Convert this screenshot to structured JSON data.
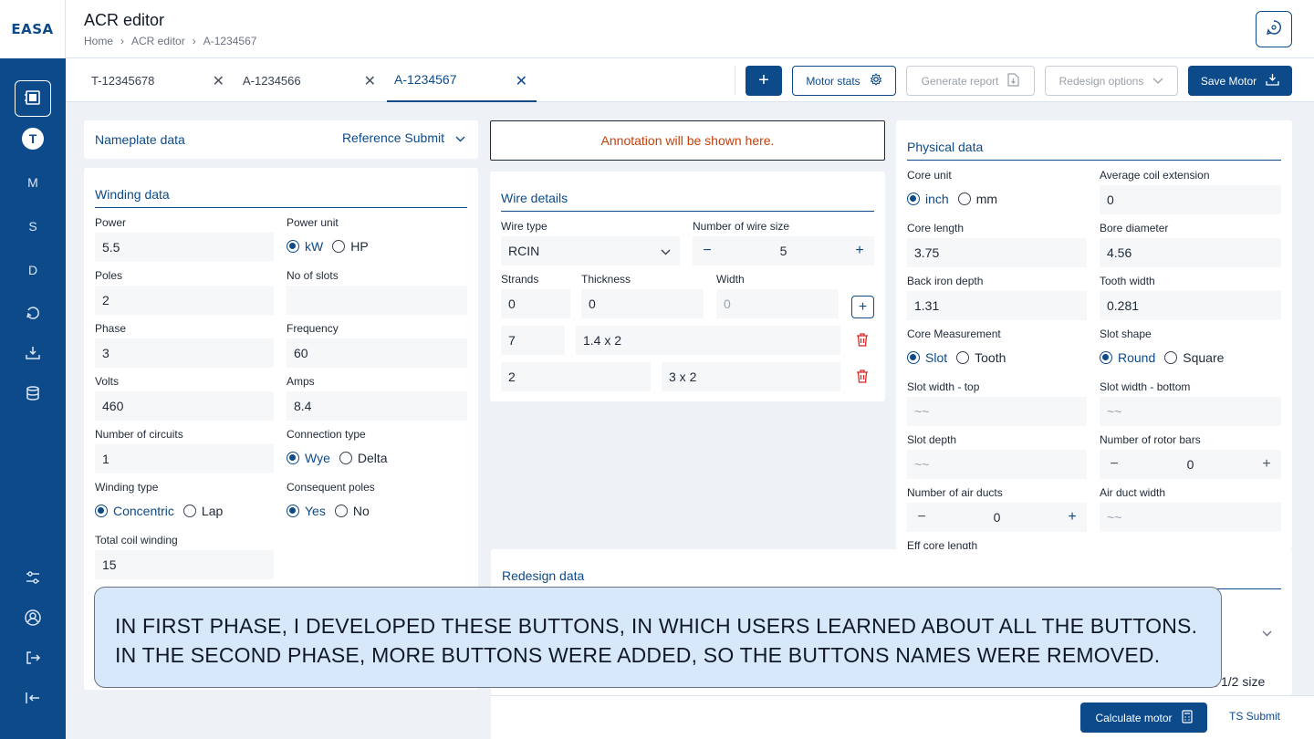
{
  "app": {
    "logo": "EASA",
    "title": "ACR editor",
    "breadcrumb": [
      "Home",
      "ACR editor",
      "A-1234567"
    ]
  },
  "sidebar": {
    "items": [
      {
        "icon": "motor-icon"
      },
      {
        "label": "T"
      },
      {
        "label": "M"
      },
      {
        "label": "S"
      },
      {
        "label": "D"
      },
      {
        "icon": "refresh-icon"
      },
      {
        "icon": "download-icon"
      },
      {
        "icon": "database-icon"
      }
    ],
    "bottom": [
      {
        "icon": "sliders-icon"
      },
      {
        "icon": "user-circle-icon"
      },
      {
        "icon": "logout-icon"
      },
      {
        "icon": "collapse-icon"
      }
    ]
  },
  "tabs": [
    {
      "label": "T-12345678"
    },
    {
      "label": "A-1234566"
    },
    {
      "label": "A-1234567",
      "active": true
    }
  ],
  "toolbar": {
    "add": "+",
    "motor_stats": "Motor stats",
    "generate_report": "Generate report",
    "redesign_options": "Redesign options",
    "save_motor": "Save Motor"
  },
  "nameplate": {
    "title": "Nameplate data",
    "reference": "Reference Submit"
  },
  "winding": {
    "title": "Winding data",
    "power_label": "Power",
    "power": "5.5",
    "power_unit_label": "Power unit",
    "power_unit_options": [
      "kW",
      "HP"
    ],
    "poles_label": "Poles",
    "poles": "2",
    "slots_label": "No of slots",
    "slots": "",
    "phase_label": "Phase",
    "phase": "3",
    "frequency_label": "Frequency",
    "frequency": "60",
    "volts_label": "Volts",
    "volts": "460",
    "amps_label": "Amps",
    "amps": "8.4",
    "circuits_label": "Number of circuits",
    "circuits": "1",
    "connection_label": "Connection type",
    "connection_options": [
      "Wye",
      "Delta"
    ],
    "winding_type_label": "Winding type",
    "winding_type_options": [
      "Concentric",
      "Lap"
    ],
    "consequent_label": "Consequent poles",
    "consequent_options": [
      "Yes",
      "No"
    ],
    "total_coil_label": "Total coil winding",
    "total_coil": "15"
  },
  "annotation": "Annotation will be shown here.",
  "wire": {
    "title": "Wire details",
    "wire_type_label": "Wire type",
    "wire_type": "RCIN",
    "wire_size_label": "Number of wire size",
    "wire_size": "5",
    "strands_label": "Strands",
    "thickness_label": "Thickness",
    "width_label": "Width",
    "row0": {
      "strands": "0",
      "thickness": "0",
      "width": "0"
    },
    "row1": {
      "strands": "7",
      "value": "1.4 x 2"
    },
    "row2": {
      "strands": "2",
      "value": "3 x 2"
    }
  },
  "physical": {
    "title": "Physical data",
    "core_unit_label": "Core unit",
    "core_unit_options": [
      "inch",
      "mm"
    ],
    "avg_coil_label": "Average coil extension",
    "avg_coil": "0",
    "core_length_label": "Core length",
    "core_length": "3.75",
    "bore_label": "Bore diameter",
    "bore": "4.56",
    "back_iron_label": "Back iron depth",
    "back_iron": "1.31",
    "tooth_width_label": "Tooth width",
    "tooth_width": "0.281",
    "core_meas_label": "Core Measurement",
    "core_meas_options": [
      "Slot",
      "Tooth"
    ],
    "slot_shape_label": "Slot shape",
    "slot_shape_options": [
      "Round",
      "Square"
    ],
    "slot_top_label": "Slot width - top",
    "slot_top": "~~",
    "slot_bottom_label": "Slot width - bottom",
    "slot_bottom": "~~",
    "slot_depth_label": "Slot depth",
    "slot_depth": "~~",
    "rotor_bars_label": "Number of rotor bars",
    "rotor_bars": "0",
    "air_ducts_label": "Number of air ducts",
    "air_ducts": "0",
    "air_duct_width_label": "Air duct width",
    "air_duct_width": "~~",
    "eff_core_label": "Eff core length"
  },
  "redesign": {
    "title": "Redesign data",
    "half_size": "1/2 size"
  },
  "caption": {
    "line1": "IN FIRST PHASE, I DEVELOPED THESE BUTTONS, IN WHICH USERS LEARNED ABOUT ALL THE BUTTONS.",
    "line2": "IN THE SECOND PHASE, MORE BUTTONS WERE ADDED, SO THE BUTTONS NAMES WERE REMOVED."
  },
  "footer": {
    "calculate": "Calculate motor",
    "ts_submit": "TS Submit"
  },
  "colors": {
    "primary": "#0c4a8a",
    "accent_orange": "#c2410c",
    "danger": "#dc2626"
  }
}
